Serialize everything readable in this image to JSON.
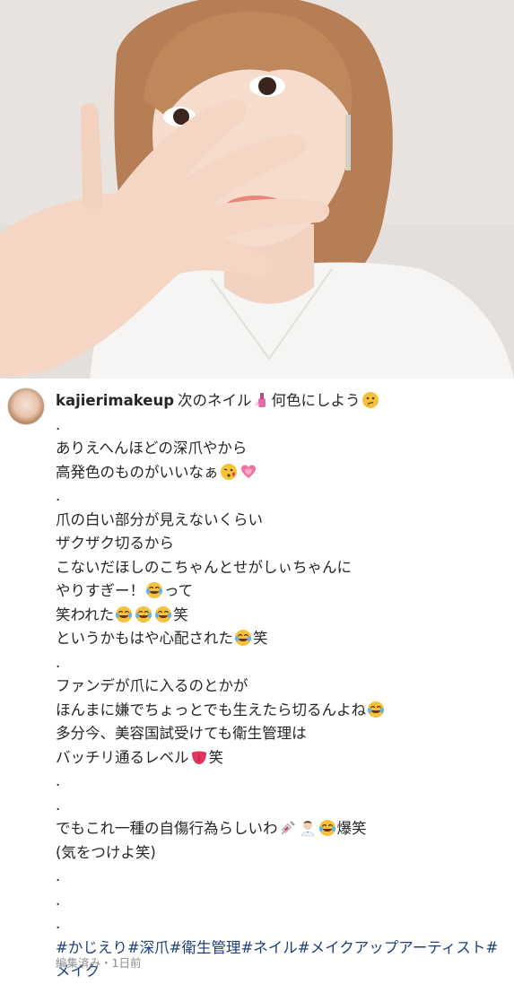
{
  "post": {
    "username": "kajierimakeup",
    "caption_lines": [
      {
        "text": "次のネイル",
        "tail": "何色にしよう"
      },
      {
        "text": "."
      },
      {
        "text": "ありえへんほどの深爪やから"
      },
      {
        "text": "高発色のものがいいなぁ"
      },
      {
        "text": "."
      },
      {
        "text": "爪の白い部分が見えないくらい"
      },
      {
        "text": "ザクザク切るから"
      },
      {
        "text": "こないだほしのこちゃんとせがしぃちゃんに"
      },
      {
        "text": "やりすぎー！",
        "tail": "って"
      },
      {
        "text": "笑われた",
        "tail": "笑"
      },
      {
        "text": "というかもはや心配された",
        "tail": "笑"
      },
      {
        "text": "."
      },
      {
        "text": "ファンデが爪に入るのとかが"
      },
      {
        "text": "ほんまに嫌でちょっとでも生えたら切るんよね"
      },
      {
        "text": "多分今、美容国試受けても衛生管理は"
      },
      {
        "text": "バッチリ通るレベル",
        "tail": "笑"
      },
      {
        "text": "."
      },
      {
        "text": "."
      },
      {
        "text": "でもこれ一種の自傷行為らしいわ",
        "tail": "爆笑"
      },
      {
        "text": "(気をつけよ笑)"
      },
      {
        "text": "."
      },
      {
        "text": "."
      },
      {
        "text": "."
      }
    ],
    "hashtags": "#かじえり#深爪#衛生管理#ネイル#メイクアップアーティスト#メイク",
    "edited_label": "編集済み・1日前"
  },
  "icons": {
    "avatar": "profile-avatar",
    "emojis": [
      "nail-polish-emoji",
      "thinking-face-emoji",
      "kissing-face-emoji",
      "growing-heart-emoji",
      "tears-of-joy-emoji",
      "tongue-emoji",
      "syringe-emoji",
      "doctor-emoji"
    ]
  }
}
